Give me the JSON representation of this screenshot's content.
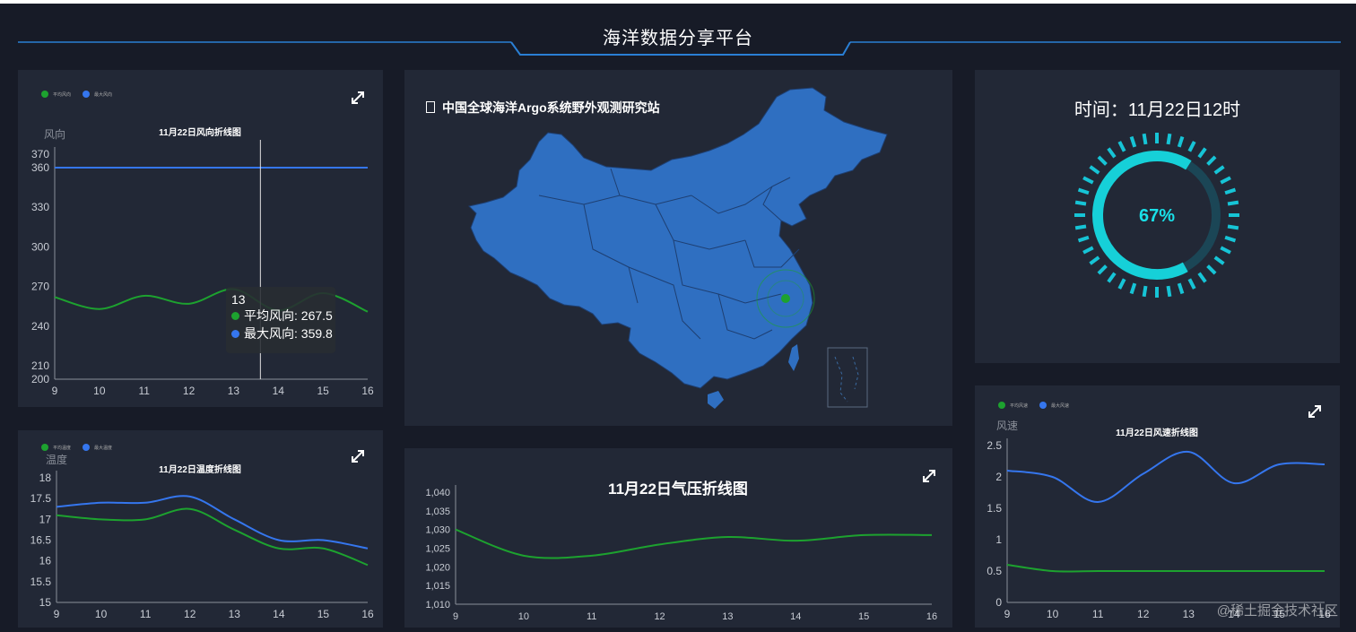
{
  "page": {
    "title": "海洋数据分享平台",
    "watermark": "@稀土掘金技术社区"
  },
  "colors": {
    "green": "#1da22f",
    "blue": "#3576ee",
    "map": "#2f6fc1",
    "gauge": "#16d0d8",
    "panel": "#222836",
    "axis": "#8a8f99"
  },
  "map": {
    "title": "中国全球海洋Argo系统野外观测研究站",
    "title_icon": "square-icon",
    "marker_icon": "station-dot-icon"
  },
  "gauge": {
    "time_label": "时间：11月22日12时",
    "value": 67,
    "value_label": "67%"
  },
  "tooltip": {
    "header": "13",
    "rows": [
      {
        "label": "平均风向: 267.5",
        "color": "#1da22f"
      },
      {
        "label": "最大风向: 359.8",
        "color": "#3576ee"
      }
    ]
  },
  "chart_data": [
    {
      "id": "wind-direction",
      "type": "line",
      "title": "11月22日风向折线图",
      "ylabel": "风向",
      "legend": [
        "平均风向",
        "最大风向"
      ],
      "x": [
        9,
        10,
        11,
        12,
        13,
        14,
        15,
        16
      ],
      "yticks": [
        200,
        210,
        240,
        270,
        300,
        330,
        360,
        370
      ],
      "ylim": [
        200,
        370
      ],
      "series": [
        {
          "name": "平均风向",
          "color": "#1da22f",
          "values": [
            262,
            253,
            263,
            257,
            268,
            252,
            265,
            251
          ]
        },
        {
          "name": "最大风向",
          "color": "#3576ee",
          "values": [
            359.8,
            359.8,
            359.8,
            359.8,
            359.8,
            359.8,
            359.8,
            359.8
          ]
        }
      ]
    },
    {
      "id": "temperature",
      "type": "line",
      "title": "11月22日温度折线图",
      "ylabel": "温度",
      "legend": [
        "平均温度",
        "最大温度"
      ],
      "x": [
        9,
        10,
        11,
        12,
        13,
        14,
        15,
        16
      ],
      "yticks": [
        15,
        15.5,
        16,
        16.5,
        17,
        17.5,
        18
      ],
      "ylim": [
        15,
        18
      ],
      "series": [
        {
          "name": "平均温度",
          "color": "#1da22f",
          "values": [
            17.1,
            17.0,
            17.0,
            17.25,
            16.75,
            16.3,
            16.3,
            15.9
          ]
        },
        {
          "name": "最大温度",
          "color": "#3576ee",
          "values": [
            17.3,
            17.4,
            17.4,
            17.55,
            17.0,
            16.5,
            16.5,
            16.3
          ]
        }
      ]
    },
    {
      "id": "pressure",
      "type": "line",
      "title": "11月22日气压折线图",
      "x": [
        9,
        10,
        11,
        12,
        13,
        14,
        15,
        16
      ],
      "yticks": [
        1010,
        1015,
        1020,
        1025,
        1030,
        1035,
        1040
      ],
      "yticklabels": [
        "1,010",
        "1,015",
        "1,020",
        "1,025",
        "1,030",
        "1,035",
        "1,040"
      ],
      "ylim": [
        1010,
        1040
      ],
      "series": [
        {
          "name": "",
          "color": "#1da22f",
          "values": [
            1030,
            1023,
            1023,
            1026,
            1028,
            1027,
            1028.5,
            1028.5
          ]
        }
      ]
    },
    {
      "id": "wind-speed",
      "type": "line",
      "title": "11月22日风速折线图",
      "ylabel": "风速",
      "legend": [
        "平均风速",
        "最大风速"
      ],
      "x": [
        9,
        10,
        11,
        12,
        13,
        14,
        15,
        16
      ],
      "yticks": [
        0,
        0.5,
        1,
        1.5,
        2,
        2.5
      ],
      "ylim": [
        0,
        2.5
      ],
      "series": [
        {
          "name": "平均风速",
          "color": "#1da22f",
          "values": [
            0.6,
            0.5,
            0.5,
            0.5,
            0.5,
            0.5,
            0.5,
            0.5
          ]
        },
        {
          "name": "最大风速",
          "color": "#3576ee",
          "values": [
            2.1,
            2.0,
            1.6,
            2.05,
            2.4,
            1.9,
            2.2,
            2.2
          ]
        }
      ]
    }
  ]
}
